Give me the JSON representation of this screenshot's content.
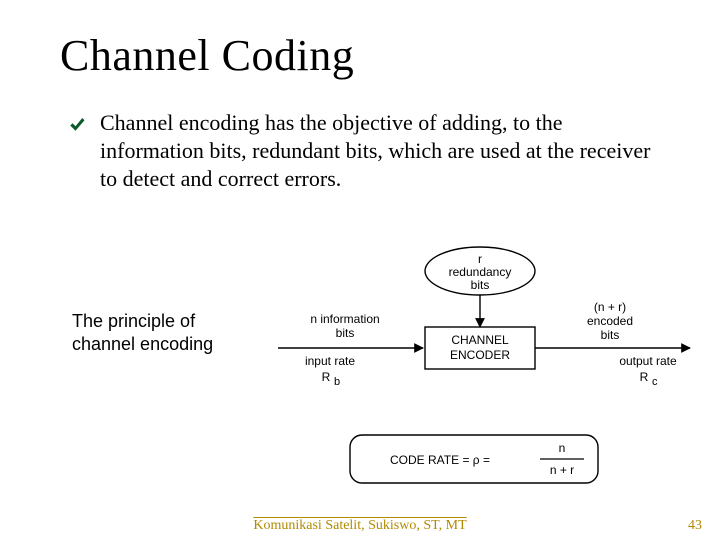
{
  "title": "Channel Coding",
  "bullet": "Channel encoding has the objective of adding, to the information bits, redundant bits, which are used at the receiver to detect and correct errors.",
  "caption": "The principle of channel encoding",
  "diagram": {
    "redundancy_top": "r",
    "redundancy_bottom": "redundancy",
    "redundancy_bits": "bits",
    "n_info": "n information",
    "n_info_bits": "bits",
    "input_rate": "input rate",
    "input_rate_sym": "R",
    "input_rate_sub": "b",
    "encoder_top": "CHANNEL",
    "encoder_bottom": "ENCODER",
    "encoded_top": "(n + r)",
    "encoded_mid": "encoded",
    "encoded_bits": "bits",
    "output_rate": "output rate",
    "output_rate_sym": "R",
    "output_rate_sub": "c",
    "code_rate_label": "CODE RATE  =  ρ  =",
    "frac_top": "n",
    "frac_bottom": "n + r"
  },
  "footer": "Komunikasi Satelit, Sukiswo, ST, MT",
  "pagenum": "43"
}
